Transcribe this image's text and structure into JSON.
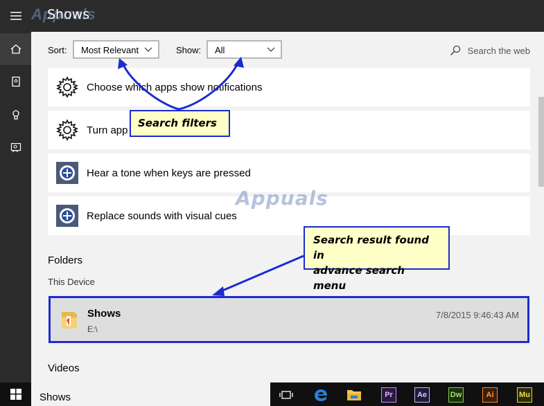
{
  "app": {
    "title": "Shows"
  },
  "filters": {
    "sort_label": "Sort:",
    "sort_value": "Most Relevant",
    "show_label": "Show:",
    "show_value": "All",
    "search_web": "Search the web"
  },
  "results": [
    {
      "text": "Choose which apps show notifications",
      "icon": "gear-icon"
    },
    {
      "text": "Turn app",
      "icon": "gear-icon"
    },
    {
      "text": "Hear a tone when keys are pressed",
      "icon": "ease-of-access-icon"
    },
    {
      "text": "Replace sounds with visual cues",
      "icon": "ease-of-access-icon"
    }
  ],
  "folders": {
    "heading": "Folders",
    "subheading": "This Device",
    "item": {
      "name": "Shows",
      "path": "E:\\",
      "date": "7/8/2015 9:46:43 AM"
    }
  },
  "videos": {
    "heading": "Videos"
  },
  "callouts": {
    "filters": "Search filters",
    "result_line1": "Search result found in",
    "result_line2": "advance search menu"
  },
  "taskbar": {
    "search_text": "Shows",
    "apps": [
      "Pr",
      "Ae",
      "Dw",
      "Ai",
      "Mu"
    ]
  },
  "watermark": "Appuals",
  "colors": {
    "callout_border": "#1a2bd0",
    "callout_bg": "#ffffc8",
    "rail_bg": "#2b2b2b"
  }
}
